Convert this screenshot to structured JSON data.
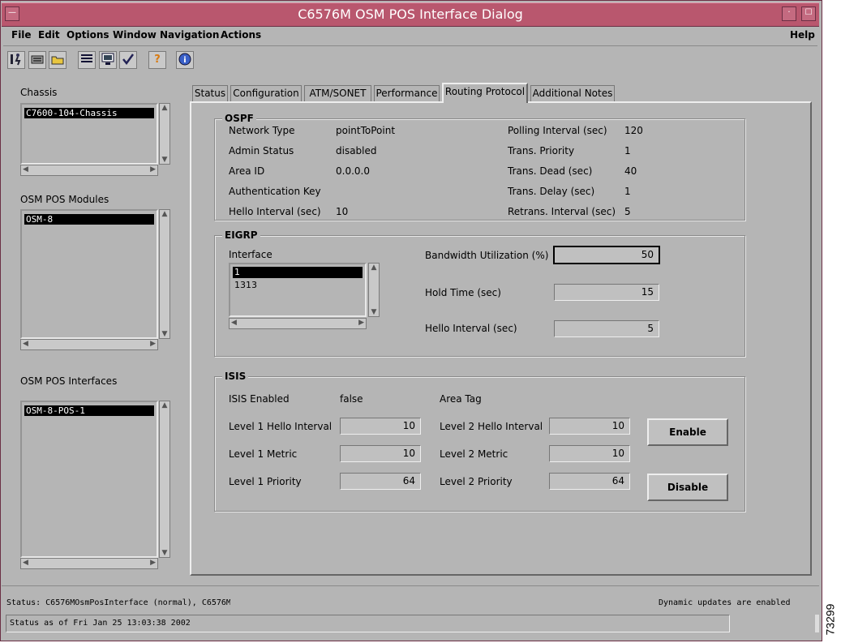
{
  "window": {
    "title": "C6576M OSM POS Interface Dialog"
  },
  "menu": {
    "file": "File",
    "edit": "Edit",
    "options": "Options",
    "window": "Window",
    "navigation": "Navigation",
    "actions": "Actions",
    "help": "Help"
  },
  "toolbar": {
    "help_glyph": "?",
    "info_glyph": "i"
  },
  "left": {
    "chassis_label": "Chassis",
    "chassis_items": [
      "C7600-104-Chassis"
    ],
    "modules_label": "OSM POS Modules",
    "modules_items": [
      "OSM-8"
    ],
    "interfaces_label": "OSM POS Interfaces",
    "interfaces_items": [
      "OSM-8-POS-1"
    ]
  },
  "tabs": [
    "Status",
    "Configuration",
    "ATM/SONET",
    "Performance",
    "Routing Protocol",
    "Additional Notes"
  ],
  "ospf": {
    "title": "OSPF",
    "network_type_label": "Network Type",
    "network_type": "pointToPoint",
    "admin_status_label": "Admin Status",
    "admin_status": "disabled",
    "area_id_label": "Area ID",
    "area_id": "0.0.0.0",
    "auth_key_label": "Authentication Key",
    "hello_interval_label": "Hello Interval (sec)",
    "hello_interval": "10",
    "polling_interval_label": "Polling Interval (sec)",
    "polling_interval": "120",
    "trans_priority_label": "Trans. Priority",
    "trans_priority": "1",
    "trans_dead_label": "Trans. Dead (sec)",
    "trans_dead": "40",
    "trans_delay_label": "Trans. Delay (sec)",
    "trans_delay": "1",
    "retrans_interval_label": "Retrans. Interval (sec)",
    "retrans_interval": "5"
  },
  "eigrp": {
    "title": "EIGRP",
    "interface_label": "Interface",
    "interfaces": [
      "1",
      "1313"
    ],
    "bandwidth_label": "Bandwidth Utilization (%)",
    "bandwidth": "50",
    "hold_time_label": "Hold Time (sec)",
    "hold_time": "15",
    "hello_interval_label": "Hello Interval (sec)",
    "hello_interval": "5"
  },
  "isis": {
    "title": "ISIS",
    "enabled_label": "ISIS Enabled",
    "enabled": "false",
    "area_tag_label": "Area Tag",
    "l1_hello_label": "Level 1 Hello Interval",
    "l1_hello": "10",
    "l1_metric_label": "Level 1 Metric",
    "l1_metric": "10",
    "l1_priority_label": "Level 1 Priority",
    "l1_priority": "64",
    "l2_hello_label": "Level 2 Hello Interval",
    "l2_hello": "10",
    "l2_metric_label": "Level 2 Metric",
    "l2_metric": "10",
    "l2_priority_label": "Level 2 Priority",
    "l2_priority": "64",
    "enable_button": "Enable",
    "disable_button": "Disable"
  },
  "status": {
    "line1": "Status: C6576MOsmPosInterface (normal), C6576M",
    "updates": "Dynamic updates are enabled",
    "line2": "Status as of Fri Jan 25 13:03:38 2002"
  },
  "side_number": "73299"
}
